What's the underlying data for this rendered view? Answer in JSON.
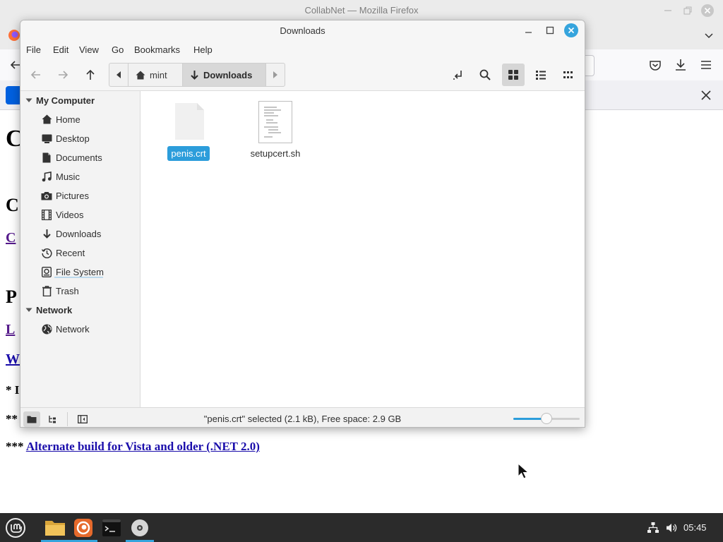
{
  "firefox": {
    "window_title": "CollabNet — Mozilla Firefox",
    "page": {
      "alternate_build_prefix": "*** ",
      "alternate_build_link": "Alternate build for Vista and older (.NET 2.0)"
    }
  },
  "file_manager": {
    "window_title": "Downloads",
    "menu": {
      "file": "File",
      "edit": "Edit",
      "view": "View",
      "go": "Go",
      "bookmarks": "Bookmarks",
      "help": "Help"
    },
    "pathbar": {
      "home_segment": "mint",
      "current_segment": "Downloads"
    },
    "sidebar": {
      "my_computer_header": "My Computer",
      "my_computer_items": [
        {
          "label": "Home",
          "icon": "home-icon"
        },
        {
          "label": "Desktop",
          "icon": "desktop-icon"
        },
        {
          "label": "Documents",
          "icon": "documents-icon"
        },
        {
          "label": "Music",
          "icon": "music-icon"
        },
        {
          "label": "Pictures",
          "icon": "camera-icon"
        },
        {
          "label": "Videos",
          "icon": "film-icon"
        },
        {
          "label": "Downloads",
          "icon": "download-icon"
        },
        {
          "label": "Recent",
          "icon": "clock-icon"
        },
        {
          "label": "File System",
          "icon": "drive-icon"
        },
        {
          "label": "Trash",
          "icon": "trash-icon"
        }
      ],
      "network_header": "Network",
      "network_items": [
        {
          "label": "Network",
          "icon": "globe-icon"
        }
      ]
    },
    "files": [
      {
        "name": "penis.crt",
        "selected": true,
        "icon": "blank-file-icon"
      },
      {
        "name": "setupcert.sh",
        "selected": false,
        "icon": "text-file-icon"
      }
    ],
    "status_text": "\"penis.crt\" selected (2.1 kB), Free space: 2.9 GB",
    "zoom_level_fraction": 0.5,
    "accent_color": "#2c9ddb"
  },
  "taskbar": {
    "clock": "05:45",
    "apps": [
      "menu-icon",
      "files-icon",
      "firefox-icon",
      "terminal-icon",
      "disc-icon"
    ]
  }
}
